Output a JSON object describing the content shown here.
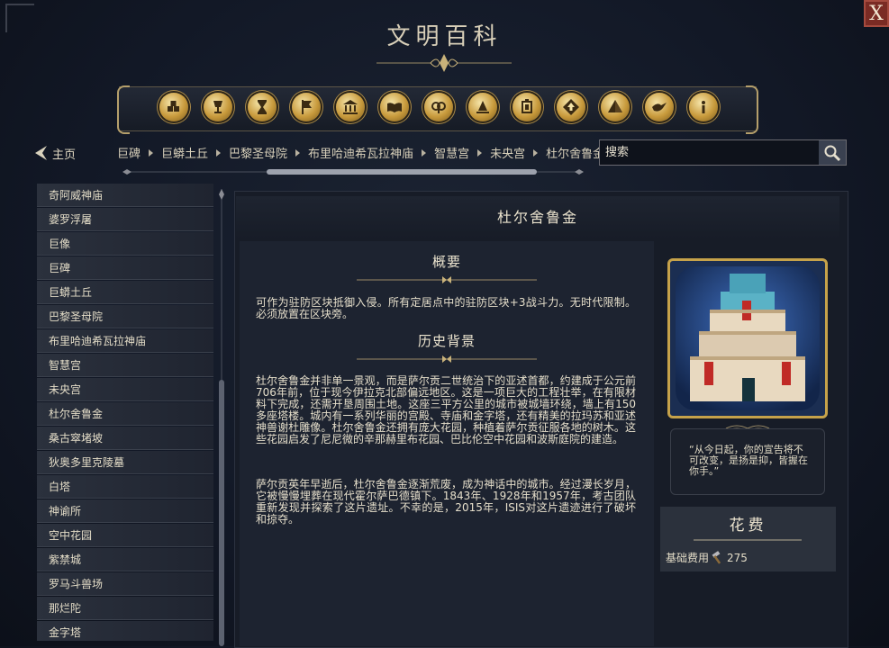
{
  "header": {
    "title": "文明百科",
    "close_label": "X"
  },
  "categories": [
    {
      "icon": "boxes-icon"
    },
    {
      "icon": "goblet-icon"
    },
    {
      "icon": "hourglass-icon"
    },
    {
      "icon": "flag-icon"
    },
    {
      "icon": "temple-icon"
    },
    {
      "icon": "book-icon"
    },
    {
      "icon": "ram-icon"
    },
    {
      "icon": "campfire-icon"
    },
    {
      "icon": "lantern-icon"
    },
    {
      "icon": "diamond-up-icon"
    },
    {
      "icon": "pyramid-icon"
    },
    {
      "icon": "dove-icon"
    },
    {
      "icon": "info-icon"
    }
  ],
  "nav": {
    "home_label": "主页",
    "breadcrumbs": [
      "巨碑",
      "巨蟒土丘",
      "巴黎圣母院",
      "布里哈迪希瓦拉神庙",
      "智慧宫",
      "未央宫",
      "杜尔舍鲁金"
    ],
    "search_placeholder": "搜索"
  },
  "sidebar": {
    "items": [
      "奇阿威神庙",
      "婆罗浮屠",
      "巨像",
      "巨碑",
      "巨蟒土丘",
      "巴黎圣母院",
      "布里哈迪希瓦拉神庙",
      "智慧宫",
      "未央宫",
      "杜尔舍鲁金",
      "桑古窣堵坡",
      "狄奥多里克陵墓",
      "白塔",
      "神谕所",
      "空中花园",
      "紫禁城",
      "罗马斗兽场",
      "那烂陀",
      "金字塔"
    ]
  },
  "article": {
    "title": "杜尔舍鲁金",
    "summary_heading": "概要",
    "summary_text": "可作为驻防区块抵御入侵。所有定居点中的驻防区块+3战斗力。无时代限制。必须放置在区块旁。",
    "history_heading": "历史背景",
    "history_p1": "杜尔舍鲁金并非单一景观，而是萨尔贡二世统治下的亚述首都，约建成于公元前706年前，位于现今伊拉克北部偏远地区。这是一项巨大的工程壮举，在有限材料下完成，还需开垦周围土地。这座三平方公里的城市被城墙环绕，墙上有150多座塔楼。城内有一系列华丽的宫殿、寺庙和金字塔，还有精美的拉玛苏和亚述神兽谢杜雕像。杜尔舍鲁金还拥有庞大花园，种植着萨尔贡征服各地的树木。这些花园启发了尼尼微的辛那赫里布花园、巴比伦空中花园和波斯庭院的建造。",
    "history_p2": "萨尔贡英年早逝后，杜尔舍鲁金逐渐荒废，成为神话中的城市。经过漫长岁月，它被慢慢埋葬在现代霍尔萨巴德镇下。1843年、1928年和1957年，考古团队重新发现并探索了这片遗址。不幸的是，2015年，ISIS对这片遗迹进行了破坏和掠夺。",
    "quote": "“从今日起，你的宣告将不可改变，是扬是抑，皆握在你手。”",
    "cost_heading": "花费",
    "base_cost_label": "基础费用",
    "base_cost_value": "275",
    "cost_icon": "hammer-icon"
  },
  "colors": {
    "accent_gold": "#c6a24a",
    "close_red": "#7a2b24",
    "panel": "#171c27"
  }
}
